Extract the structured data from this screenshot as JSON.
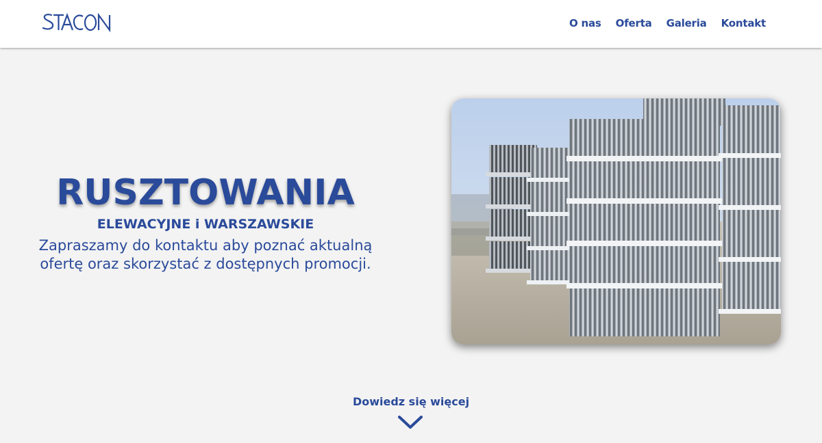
{
  "header": {
    "logo_text": "STACON",
    "nav": [
      {
        "label": "O nas"
      },
      {
        "label": "Oferta"
      },
      {
        "label": "Galeria"
      },
      {
        "label": "Kontakt"
      }
    ]
  },
  "hero": {
    "title": "RUSZTOWANIA",
    "subtitle": "ELEWACYJNE i WARSZAWSKIE",
    "description_line1": "Zapraszamy do kontaktu aby poznać aktualną",
    "description_line2": "ofertę oraz skorzystać z dostępnych promocji."
  },
  "cta": {
    "label": "Dowiedz się więcej",
    "icon": "chevron-down-icon"
  },
  "colors": {
    "brand": "#2a4a9a",
    "background": "#f3f3f3",
    "header_background": "#ffffff"
  }
}
